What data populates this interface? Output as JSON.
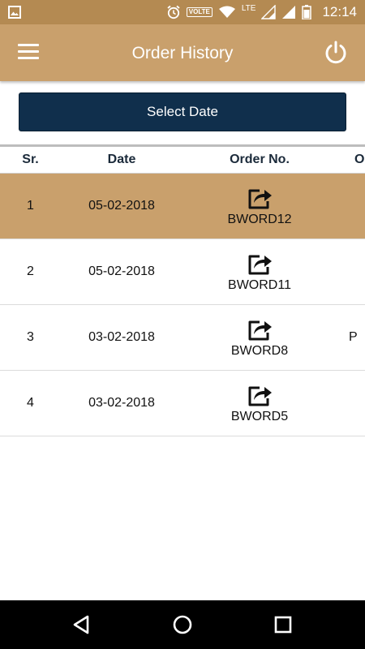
{
  "status_bar": {
    "left_icon": "image-icon",
    "volte": "VOLTE",
    "lte": "LTE",
    "time": "12:14",
    "icons": [
      "alarm-icon",
      "wifi-icon",
      "signal-icon",
      "signal-icon",
      "battery-icon"
    ]
  },
  "app_bar": {
    "title": "Order History",
    "menu_icon": "hamburger-menu-icon",
    "power_icon": "power-icon",
    "color": "#c9a06c"
  },
  "select_date": {
    "label": "Select Date",
    "color": "#102f4c"
  },
  "table": {
    "headers": [
      "Sr.",
      "Date",
      "Order No.",
      "O"
    ],
    "rows": [
      {
        "sr": "1",
        "date": "05-02-2018",
        "order_no": "BWORD12",
        "extra": "",
        "selected": true
      },
      {
        "sr": "2",
        "date": "05-02-2018",
        "order_no": "BWORD11",
        "extra": ""
      },
      {
        "sr": "3",
        "date": "03-02-2018",
        "order_no": "BWORD8",
        "extra": "P"
      },
      {
        "sr": "4",
        "date": "03-02-2018",
        "order_no": "BWORD5",
        "extra": ""
      }
    ],
    "row_icon": "share-icon",
    "selected_color": "#c9a06c"
  },
  "nav_bar": {
    "icons": [
      "back-icon",
      "home-icon",
      "recents-icon"
    ]
  }
}
